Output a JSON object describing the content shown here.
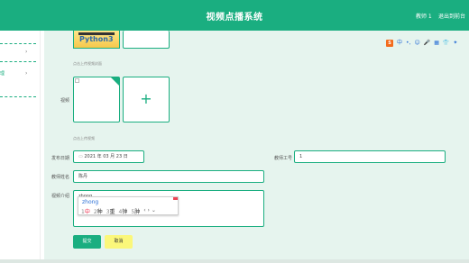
{
  "header": {
    "title": "视频点播系统",
    "user": "教师 1",
    "exit": "退出到前台"
  },
  "form": {
    "cover_hint": "点击上传视频封面",
    "video_label": "视频",
    "video_hint": "点击上传视频",
    "upload_plus": "+",
    "date_label": "发布日期",
    "date_value": "2021 年 03 月 23 日",
    "teacher_id_label": "教师工号",
    "teacher_id_value": "1",
    "teacher_name_label": "教师姓名",
    "teacher_name_value": "陈丹",
    "intro_label": "视频介绍",
    "intro_value": "zhong"
  },
  "cover_image": {
    "top_text": "",
    "main_text": "Python3",
    "bottom_text": ""
  },
  "ime": {
    "pinyin": "zhong",
    "candidates": [
      {
        "n": "1",
        "c": "中"
      },
      {
        "n": "2",
        "c": "种"
      },
      {
        "n": "3",
        "c": "重"
      },
      {
        "n": "4",
        "c": "钟"
      },
      {
        "n": "5",
        "c": "肿"
      }
    ],
    "more": "‹ › ⌄"
  },
  "toolbar": {
    "logo": "S",
    "items": [
      "中",
      "•,",
      "☺",
      "🎤",
      "▦",
      "👕",
      "✦"
    ]
  },
  "buttons": {
    "submit": "提交",
    "cancel": "取消"
  }
}
